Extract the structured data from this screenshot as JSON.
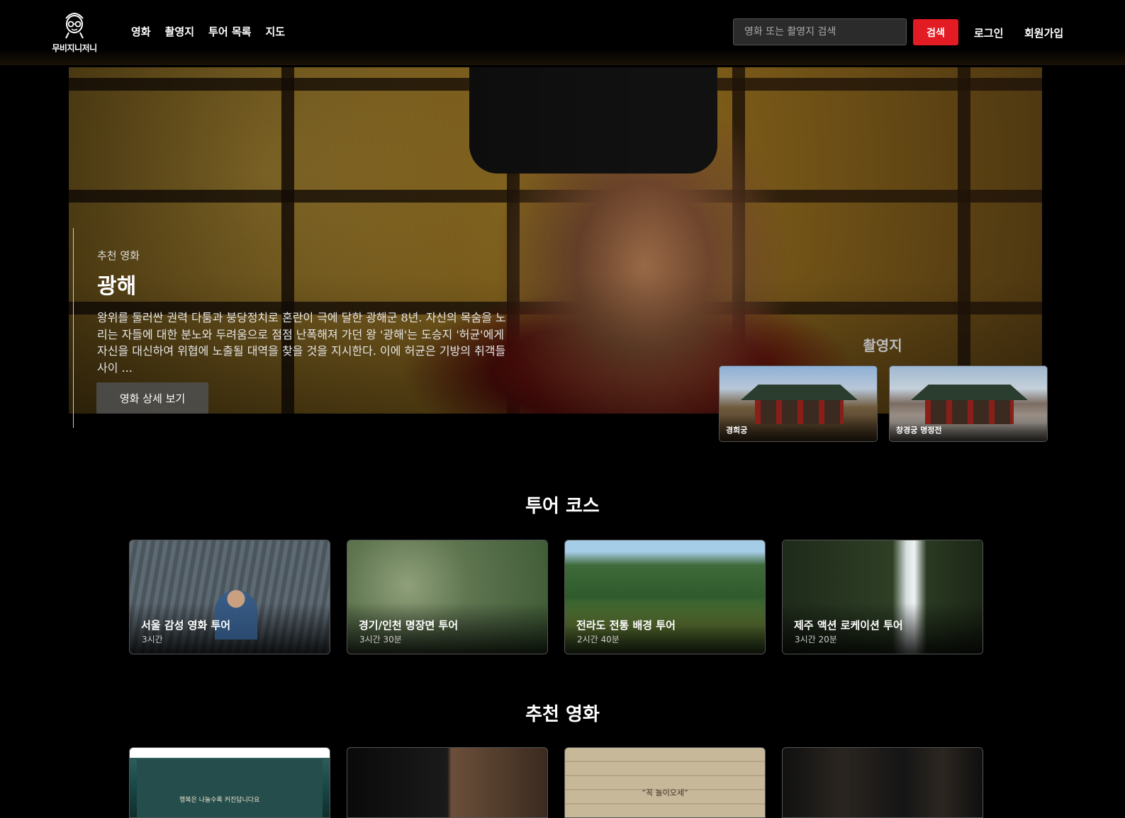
{
  "header": {
    "logo_text": "무비지니저니",
    "nav": [
      "영화",
      "촬영지",
      "투어 목록",
      "지도"
    ],
    "search_placeholder": "영화 또는 촬영지 검색",
    "search_button": "검색",
    "login": "로그인",
    "signup": "회원가입"
  },
  "hero": {
    "eyebrow": "추천 영화",
    "title": "광해",
    "description": "왕위를 둘러싼 권력 다툼과 붕당정치로 혼란이 극에 달한 광해군 8년. 자신의 목숨을 노리는 자들에 대한 분노와 두려움으로 점점 난폭해져 가던 왕 '광해'는 도승지 '허균'에게 자신을 대신하여 위협에 노출될 대역을 찾을 것을 지시한다. 이에 허균은 기방의 취객들 사이 ...",
    "detail_button": "영화 상세 보기",
    "locations_title": "촬영지",
    "locations": [
      {
        "name": "경희궁"
      },
      {
        "name": "창경궁 명정전"
      }
    ]
  },
  "tours": {
    "title": "투어 코스",
    "items": [
      {
        "name": "서울 감성 영화 투어",
        "duration": "3시간"
      },
      {
        "name": "경기/인천 명장면 투어",
        "duration": "3시간 30분"
      },
      {
        "name": "전라도 전통 배경 투어",
        "duration": "2시간 40분"
      },
      {
        "name": "제주 액션 로케이션 투어",
        "duration": "3시간 20분"
      }
    ]
  },
  "movies": {
    "title": "추천 영화",
    "poster1_caption": "행복은 나눌수록 커진답니다요",
    "poster3_quote": "“꼭 놀이오세”"
  },
  "colors": {
    "accent": "#e31b23",
    "background": "#000000"
  }
}
